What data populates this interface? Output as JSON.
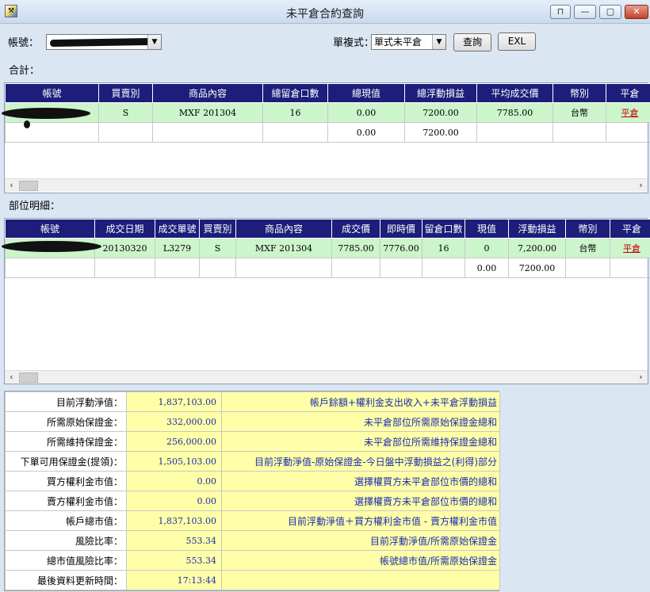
{
  "window": {
    "title": "未平倉合約查詢",
    "icon": "app-icon",
    "controls": [
      "restore",
      "minimize",
      "maximize",
      "close"
    ]
  },
  "form": {
    "account_label": "帳號：",
    "mode_label": "單複式：",
    "mode_value": "單式未平倉",
    "query_button": "查詢",
    "exl_button": "EXL"
  },
  "totals": {
    "section_label": "合計：",
    "columns": [
      "帳號",
      "買賣別",
      "商品內容",
      "總留倉口數",
      "總現值",
      "總浮動損益",
      "平均成交價",
      "幣別",
      "平倉"
    ],
    "rows": [
      [
        "",
        "S",
        "MXF 201304",
        "16",
        "0.00",
        "7200.00",
        "7785.00",
        "台幣",
        "平倉"
      ],
      [
        "",
        "",
        "",
        "",
        "0.00",
        "7200.00",
        "",
        "",
        ""
      ]
    ]
  },
  "details": {
    "section_label": "部位明細：",
    "columns": [
      "帳號",
      "成交日期",
      "成交單號",
      "買賣別",
      "商品內容",
      "成交價",
      "即時價",
      "留倉口數",
      "現值",
      "浮動損益",
      "幣別",
      "平倉"
    ],
    "rows": [
      [
        "",
        "20130320",
        "L3279",
        "S",
        "MXF 201304",
        "7785.00",
        "7776.00",
        "16",
        "0",
        "7,200.00",
        "台幣",
        "平倉"
      ],
      [
        "",
        "",
        "",
        "",
        "",
        "",
        "",
        "",
        "0.00",
        "7200.00",
        "",
        ""
      ]
    ]
  },
  "summary": [
    {
      "label": "目前浮動淨值：",
      "value": "1,837,103.00",
      "formula": "帳戶餘額+權利金支出收入+未平倉浮動損益"
    },
    {
      "label": "所需原始保證金：",
      "value": "332,000.00",
      "formula": "未平倉部位所需原始保證金總和"
    },
    {
      "label": "所需維持保證金：",
      "value": "256,000.00",
      "formula": "未平倉部位所需維持保證金總和"
    },
    {
      "label": "下單可用保證金(提領)：",
      "value": "1,505,103.00",
      "formula": "目前浮動淨值-原始保證金-今日盤中浮動損益之(利得)部分"
    },
    {
      "label": "買方權利金市值：",
      "value": "0.00",
      "formula": "選擇權買方未平倉部位市價的總和"
    },
    {
      "label": "賣方權利金市值：",
      "value": "0.00",
      "formula": "選擇權賣方未平倉部位市價的總和"
    },
    {
      "label": "帳戶總市值：",
      "value": "1,837,103.00",
      "formula": "目前浮動淨值＋買方權利金市值 - 賣方權利金市值"
    },
    {
      "label": "風險比率：",
      "value": "553.34",
      "formula": "目前浮動淨值/所需原始保證金"
    },
    {
      "label": "總市值風險比率：",
      "value": "553.34",
      "formula": "帳號總市值/所需原始保證金"
    },
    {
      "label": "最後資料更新時間：",
      "value": "17:13:44",
      "formula": ""
    }
  ],
  "colors": {
    "header_bg": "#1c1e7a",
    "highlight_row": "#ccf5cc",
    "summary_bg": "#ffffa8",
    "summary_text": "#1a2db0",
    "link": "#c00000"
  }
}
